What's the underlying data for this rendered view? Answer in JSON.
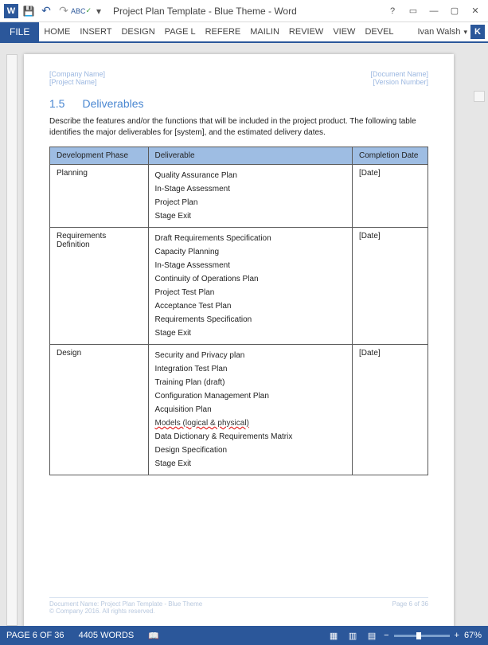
{
  "app": {
    "title": "Project Plan Template - Blue Theme - Word"
  },
  "ribbon": {
    "file": "FILE",
    "tabs": [
      "HOME",
      "INSERT",
      "DESIGN",
      "PAGE L",
      "REFERE",
      "MAILIN",
      "REVIEW",
      "VIEW",
      "DEVEL"
    ]
  },
  "user": {
    "name": "Ivan Walsh",
    "badge": "K"
  },
  "doc_header": {
    "left1": "[Company Name]",
    "left2": "[Project Name]",
    "right1": "[Document Name]",
    "right2": "[Version Number]"
  },
  "section": {
    "number": "1.5",
    "title": "Deliverables",
    "body": "Describe the features and/or the functions that will be included in the project product. The following table identifies the major deliverables for [system], and the estimated delivery dates."
  },
  "table": {
    "headers": [
      "Development Phase",
      "Deliverable",
      "Completion Date"
    ],
    "rows": [
      {
        "phase": "Planning",
        "deliverables": [
          "Quality Assurance Plan",
          "In-Stage Assessment",
          "Project Plan",
          "Stage Exit"
        ],
        "date": "[Date]"
      },
      {
        "phase": "Requirements Definition",
        "deliverables": [
          "Draft Requirements Specification",
          "Capacity Planning",
          "In-Stage Assessment",
          "Continuity of Operations Plan",
          "Project Test Plan",
          "Acceptance Test Plan",
          "Requirements Specification",
          "Stage Exit"
        ],
        "date": "[Date]"
      },
      {
        "phase": "Design",
        "deliverables": [
          "Security and Privacy plan",
          "Integration Test Plan",
          "Training Plan (draft)",
          "Configuration Management Plan",
          "Acquisition Plan",
          "Models (logical & physical)",
          "Data Dictionary & Requirements Matrix",
          "Design Specification",
          "Stage Exit"
        ],
        "date": "[Date]",
        "spelling_error_index": 5
      }
    ]
  },
  "doc_footer": {
    "left1": "Document Name: Project Plan Template - Blue Theme",
    "left2": "© Company 2016. All rights reserved.",
    "right": "Page 6 of 36"
  },
  "status": {
    "page": "PAGE 6 OF 36",
    "words": "4405 WORDS",
    "zoom": "67%"
  }
}
